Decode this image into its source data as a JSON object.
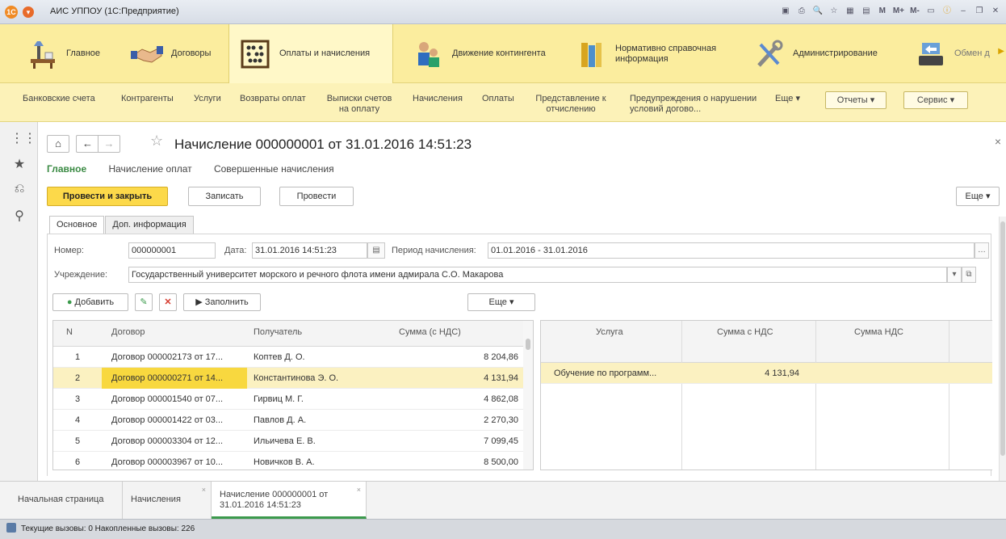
{
  "window": {
    "title": "АИС УППОУ  (1С:Предприятие)",
    "tools": [
      "M",
      "M+",
      "M-"
    ]
  },
  "sections": [
    {
      "label": "Главное",
      "icon": "desk-icon"
    },
    {
      "label": "Договоры",
      "icon": "handshake-icon"
    },
    {
      "label": "Оплаты и начисления",
      "icon": "abacus-icon",
      "active": true
    },
    {
      "label": "Движение контингента",
      "icon": "people-icon"
    },
    {
      "label": "Нормативно справочная информация",
      "icon": "books-icon"
    },
    {
      "label": "Администрирование",
      "icon": "tools-icon"
    },
    {
      "label": "Обмен д",
      "icon": "exchange-icon"
    }
  ],
  "subnav": {
    "items": [
      "Банковские счета",
      "Контрагенты",
      "Услуги",
      "Возвраты оплат",
      "Выписки счетов на оплату",
      "Начисления",
      "Оплаты",
      "Представление к отчислению",
      "Предупреждения о нарушении условий догово..."
    ],
    "more": "Еще ▾",
    "reports": "Отчеты ▾",
    "service": "Сервис ▾"
  },
  "doc": {
    "title": "Начисление 000000001 от 31.01.2016 14:51:23",
    "tabs": [
      "Главное",
      "Начисление оплат",
      "Совершенные начисления"
    ],
    "buttons": {
      "post_close": "Провести и закрыть",
      "save": "Записать",
      "post": "Провести",
      "more": "Еще  ▾"
    },
    "page_tabs": [
      "Основное",
      "Доп. информация"
    ],
    "fields": {
      "number_label": "Номер:",
      "number": "000000001",
      "date_label": "Дата:",
      "date": "31.01.2016 14:51:23",
      "period_label": "Период начисления:",
      "period": "01.01.2016 - 31.01.2016",
      "org_label": "Учреждение:",
      "org": "Государственный университет морского и речного флота имени адмирала С.О. Макарова"
    },
    "table_buttons": {
      "add": "Добавить",
      "fill": "▶ Заполнить",
      "more": "Еще  ▾"
    }
  },
  "left_table": {
    "headers": [
      "N",
      "Договор",
      "Получатель",
      "Сумма (с НДС)"
    ],
    "rows": [
      {
        "n": "1",
        "contract": "Договор 000002173 от 17...",
        "recipient": "Коптев Д. О.",
        "sum": "8 204,86"
      },
      {
        "n": "2",
        "contract": "Договор 000000271 от 14...",
        "recipient": "Константинова Э. О.",
        "sum": "4 131,94",
        "selected": true
      },
      {
        "n": "3",
        "contract": "Договор 000001540 от 07...",
        "recipient": "Гирвиц М. Г.",
        "sum": "4 862,08"
      },
      {
        "n": "4",
        "contract": "Договор 000001422 от 03...",
        "recipient": "Павлов Д. А.",
        "sum": "2 270,30"
      },
      {
        "n": "5",
        "contract": "Договор 000003304 от 12...",
        "recipient": "Ильичева Е. В.",
        "sum": "7 099,45"
      },
      {
        "n": "6",
        "contract": "Договор 000003967 от 10...",
        "recipient": "Новичков В. А.",
        "sum": "8 500,00"
      }
    ]
  },
  "right_table": {
    "headers": [
      "Услуга",
      "Сумма с НДС",
      "Сумма НДС"
    ],
    "rows": [
      {
        "service": "Обучение по программ...",
        "sum": "4 131,94",
        "vat": ""
      }
    ]
  },
  "open_tabs": [
    "Начальная страница",
    "Начисления",
    "Начисление 000000001 от 31.01.2016 14:51:23"
  ],
  "status": "Текущие вызовы: 0   Накопленные вызовы: 226"
}
